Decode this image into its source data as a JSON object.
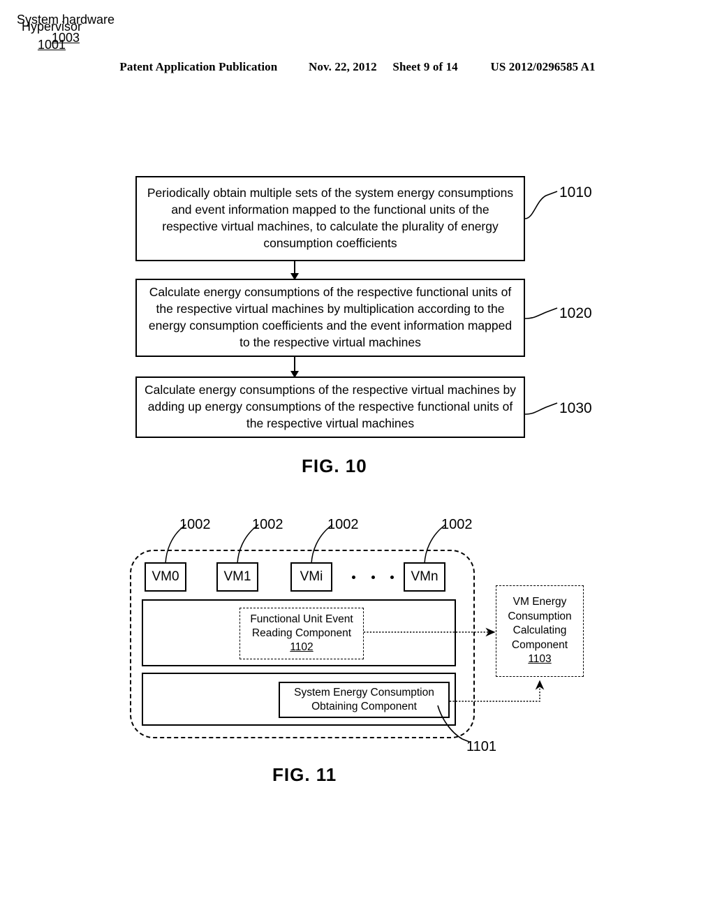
{
  "header": {
    "publication": "Patent Application Publication",
    "date": "Nov. 22, 2012",
    "sheet": "Sheet 9 of 14",
    "doc_number": "US 2012/0296585 A1"
  },
  "fig10": {
    "caption": "FIG. 10",
    "steps": [
      {
        "ref": "1010",
        "text": "Periodically obtain multiple sets of the system energy consumptions and event information mapped to the functional units of the respective virtual machines, to calculate the plurality of energy consumption coefficients"
      },
      {
        "ref": "1020",
        "text": "Calculate energy consumptions of the respective functional units of the respective virtual machines by multiplication according to the energy consumption coefficients and the event information mapped to the respective virtual machines"
      },
      {
        "ref": "1030",
        "text": "Calculate energy consumptions of the respective virtual machines by adding up energy consumptions of the respective functional units of the respective virtual machines"
      }
    ]
  },
  "fig11": {
    "caption": "FIG. 11",
    "system_ref": "1101",
    "vm_ref": "1002",
    "vms": [
      {
        "label": "VM0",
        "ref": "1002"
      },
      {
        "label": "VM1",
        "ref": "1002"
      },
      {
        "label": "VMi",
        "ref": "1002"
      },
      {
        "label": "VMn",
        "ref": "1002"
      }
    ],
    "ellipsis": "• • •",
    "hypervisor": {
      "label": "Hypervisor",
      "ref": "1001"
    },
    "hardware": {
      "label": "System hardware",
      "ref": "1003"
    },
    "event_reading_component": {
      "line1": "Functional Unit Event",
      "line2": "Reading Component",
      "ref": "1102"
    },
    "system_energy_component": {
      "line1": "System Energy Consumption",
      "line2": "Obtaining Component"
    },
    "vm_energy_component": {
      "line1": "VM Energy",
      "line2": "Consumption",
      "line3": "Calculating",
      "line4": "Component",
      "ref": "1103"
    }
  },
  "colors": {
    "ink": "#000000",
    "paper": "#ffffff"
  }
}
